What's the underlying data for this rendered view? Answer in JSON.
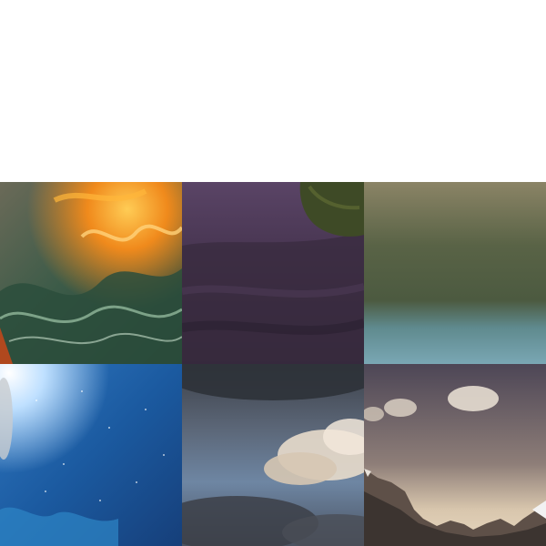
{
  "gallery": {
    "tiles": [
      {
        "subject": "fiery-ocean-wave",
        "colors": {
          "primary": "#2f4a3a",
          "accent": "#f08a1c"
        }
      },
      {
        "subject": "purple-shoreline-rock",
        "colors": {
          "primary": "#4a3550",
          "accent": "#3f4a2a"
        }
      },
      {
        "subject": "blurred-green-landscape",
        "colors": {
          "primary": "#5f6a4e",
          "accent": "#6f9aa8"
        }
      },
      {
        "subject": "blue-water-splash",
        "colors": {
          "primary": "#1d5aa0",
          "accent": "#bfe0ff"
        }
      },
      {
        "subject": "stormy-cloud-sky",
        "colors": {
          "primary": "#4a5260",
          "accent": "#e8dccb"
        }
      },
      {
        "subject": "mountain-peaks-dusk",
        "colors": {
          "primary": "#585060",
          "accent": "#f2f2f2"
        }
      }
    ]
  }
}
